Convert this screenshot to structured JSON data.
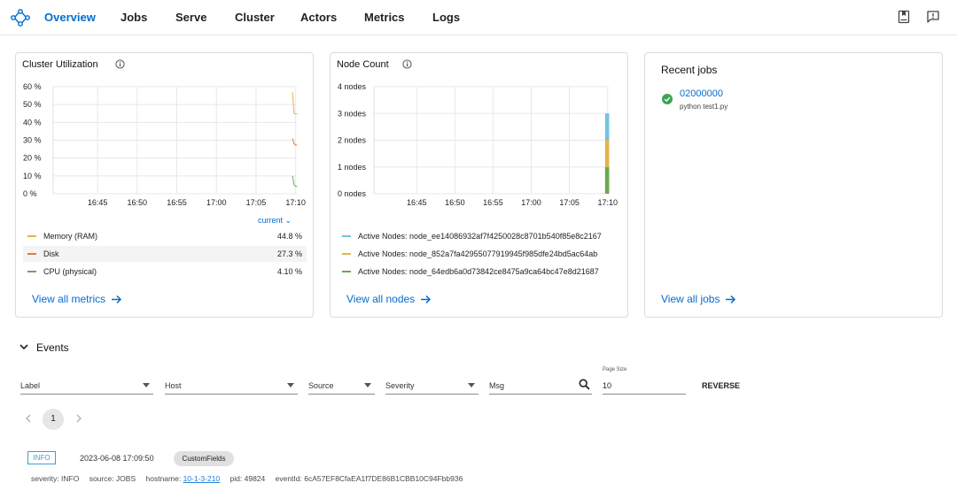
{
  "nav": {
    "items": [
      {
        "label": "Overview",
        "active": true
      },
      {
        "label": "Jobs"
      },
      {
        "label": "Serve"
      },
      {
        "label": "Cluster"
      },
      {
        "label": "Actors"
      },
      {
        "label": "Metrics"
      },
      {
        "label": "Logs"
      }
    ],
    "right_icons": [
      "docs-icon",
      "feedback-icon"
    ]
  },
  "cluster_utilization": {
    "title": "Cluster Utilization",
    "current_label": "current",
    "legend": [
      {
        "name": "Memory (RAM)",
        "value": "44.8 %",
        "color": "#e6b24a"
      },
      {
        "name": "Disk",
        "value": "27.3 %",
        "color": "#e07a3e"
      },
      {
        "name": "CPU (physical)",
        "value": "4.10 %",
        "color": "#6aa84f"
      }
    ],
    "view_all": "View all metrics"
  },
  "node_count": {
    "title": "Node Count",
    "legend": [
      {
        "name": "Active Nodes: node_ee14086932af7f4250028c8701b540f85e8c2167",
        "color": "#74c3dc"
      },
      {
        "name": "Active Nodes: node_852a7fa42955077919945f985dfe24bd5ac64ab",
        "color": "#e6b24a"
      },
      {
        "name": "Active Nodes: node_64edb6a0d73842ce8475a9ca64bc47e8d21687",
        "color": "#6aa84f"
      }
    ],
    "view_all": "View all nodes"
  },
  "recent_jobs": {
    "title": "Recent jobs",
    "jobs": [
      {
        "id": "02000000",
        "command": "python test1.py",
        "status": "success"
      }
    ],
    "view_all": "View all jobs"
  },
  "chart_data": [
    {
      "type": "line",
      "title": "Cluster Utilization",
      "x_ticks": [
        "16:45",
        "16:50",
        "16:55",
        "17:00",
        "17:05",
        "17:10"
      ],
      "y_ticks": [
        "60 %",
        "50 %",
        "40 %",
        "30 %",
        "20 %",
        "10 %",
        "0 %"
      ],
      "ylim": [
        0,
        60
      ],
      "grid": true,
      "series": [
        {
          "name": "Memory (RAM)",
          "color": "#e6b24a",
          "x": [
            "17:09:36",
            "17:09:48",
            "17:10:00",
            "17:10:12"
          ],
          "values": [
            57,
            45,
            44.8,
            44.8
          ]
        },
        {
          "name": "Disk",
          "color": "#e07a3e",
          "x": [
            "17:09:36",
            "17:09:48",
            "17:10:00",
            "17:10:12"
          ],
          "values": [
            31,
            28,
            27.3,
            27.3
          ]
        },
        {
          "name": "CPU (physical)",
          "color": "#6aa84f",
          "x": [
            "17:09:36",
            "17:09:48",
            "17:10:00",
            "17:10:12"
          ],
          "values": [
            10,
            5,
            4.1,
            4.1
          ]
        }
      ]
    },
    {
      "type": "area",
      "title": "Node Count",
      "x_ticks": [
        "16:45",
        "16:50",
        "16:55",
        "17:00",
        "17:05",
        "17:10"
      ],
      "y_ticks": [
        "4 nodes",
        "3 nodes",
        "2 nodes",
        "1 nodes",
        "0 nodes"
      ],
      "ylim": [
        0,
        4
      ],
      "grid": true,
      "stacked": true,
      "series": [
        {
          "name": "Active Nodes: node_64edb6a0d73842ce8475a9ca64bc47e8d21687",
          "color": "#6aa84f",
          "x": [
            "17:09:40",
            "17:10:12"
          ],
          "values": [
            1,
            1
          ]
        },
        {
          "name": "Active Nodes: node_852a7fa42955077919945f985dfe24bd5ac64ab",
          "color": "#e6b24a",
          "x": [
            "17:09:40",
            "17:10:12"
          ],
          "values": [
            1,
            1
          ]
        },
        {
          "name": "Active Nodes: node_ee14086932af7f4250028c8701b540f85e8c2167",
          "color": "#74c3dc",
          "x": [
            "17:09:40",
            "17:10:12"
          ],
          "values": [
            1,
            1
          ]
        }
      ]
    }
  ],
  "events": {
    "title": "Events",
    "filters": {
      "label": "Label",
      "host": "Host",
      "source": "Source",
      "severity": "Severity",
      "msg": "Msg",
      "page_size_label": "Page Size",
      "page_size": "10"
    },
    "reverse_label": "REVERSE",
    "current_page": "1",
    "items": [
      {
        "severity_badge": "INFO",
        "time": "2023-06-08 17:09:50",
        "custom_fields": "CustomFields",
        "meta": {
          "severity": "severity: INFO",
          "source": "source: JOBS",
          "hostname_label": "hostname:",
          "hostname": "10-1-3-210",
          "pid": "pid: 49824",
          "event_id": "eventId: 6cA57EF8CfaEA1f7DE86B1CBB10C94Fbb936"
        }
      }
    ]
  }
}
